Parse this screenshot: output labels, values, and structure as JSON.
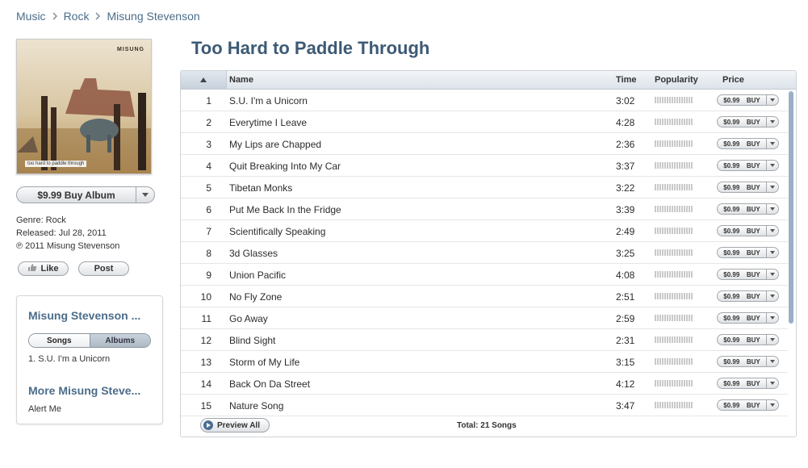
{
  "breadcrumb": {
    "items": [
      "Music",
      "Rock",
      "Misung Stevenson"
    ],
    "separator_icon": "chevron-right-icon"
  },
  "album": {
    "title": "Too Hard to Paddle Through",
    "art_brand": "MISUNG",
    "art_caption": "too hard to paddle through",
    "buy_label": "$9.99 Buy Album",
    "genre": "Genre: Rock",
    "released": "Released: Jul 28, 2011",
    "copyright": "℗ 2011 Misung Stevenson"
  },
  "social": {
    "like_label": "Like",
    "post_label": "Post"
  },
  "artist_box": {
    "title": "Misung Stevenson ...",
    "tabs": [
      "Songs",
      "Albums"
    ],
    "active_tab": "Songs",
    "top_song": "1. S.U. I'm a Unicorn",
    "more_title": "More Misung Steve...",
    "alert_label": "Alert Me"
  },
  "table": {
    "sort_icon": "sort-ascending-icon",
    "headers": {
      "name": "Name",
      "time": "Time",
      "popularity": "Popularity",
      "price": "Price"
    },
    "rows": [
      {
        "num": "1",
        "name": "S.U. I'm a Unicorn",
        "time": "3:02",
        "price": "$0.99",
        "buy": "BUY"
      },
      {
        "num": "2",
        "name": "Everytime I Leave",
        "time": "4:28",
        "price": "$0.99",
        "buy": "BUY"
      },
      {
        "num": "3",
        "name": "My Lips are Chapped",
        "time": "2:36",
        "price": "$0.99",
        "buy": "BUY"
      },
      {
        "num": "4",
        "name": "Quit Breaking Into My Car",
        "time": "3:37",
        "price": "$0.99",
        "buy": "BUY"
      },
      {
        "num": "5",
        "name": "Tibetan Monks",
        "time": "3:22",
        "price": "$0.99",
        "buy": "BUY"
      },
      {
        "num": "6",
        "name": "Put Me Back In the Fridge",
        "time": "3:39",
        "price": "$0.99",
        "buy": "BUY"
      },
      {
        "num": "7",
        "name": "Scientifically Speaking",
        "time": "2:49",
        "price": "$0.99",
        "buy": "BUY"
      },
      {
        "num": "8",
        "name": "3d Glasses",
        "time": "3:25",
        "price": "$0.99",
        "buy": "BUY"
      },
      {
        "num": "9",
        "name": "Union Pacific",
        "time": "4:08",
        "price": "$0.99",
        "buy": "BUY"
      },
      {
        "num": "10",
        "name": "No Fly Zone",
        "time": "2:51",
        "price": "$0.99",
        "buy": "BUY"
      },
      {
        "num": "11",
        "name": "Go Away",
        "time": "2:59",
        "price": "$0.99",
        "buy": "BUY"
      },
      {
        "num": "12",
        "name": "Blind Sight",
        "time": "2:31",
        "price": "$0.99",
        "buy": "BUY"
      },
      {
        "num": "13",
        "name": "Storm of My Life",
        "time": "3:15",
        "price": "$0.99",
        "buy": "BUY"
      },
      {
        "num": "14",
        "name": "Back On Da Street",
        "time": "4:12",
        "price": "$0.99",
        "buy": "BUY"
      },
      {
        "num": "15",
        "name": "Nature Song",
        "time": "3:47",
        "price": "$0.99",
        "buy": "BUY"
      }
    ],
    "preview_all_label": "Preview All",
    "total_label": "Total: 21 Songs"
  },
  "colors": {
    "link": "#4b6d8a",
    "title": "#3d5a75",
    "scroll_thumb": "#9ab0c8"
  }
}
